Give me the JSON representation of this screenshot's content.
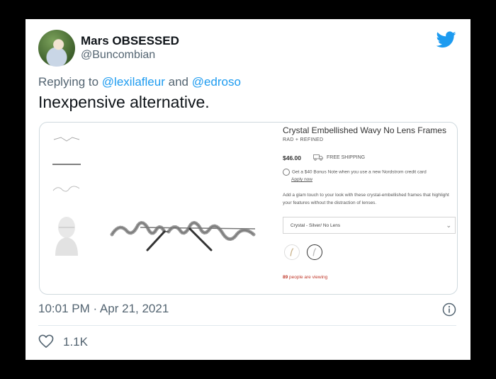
{
  "tweet": {
    "display_name": "Mars OBSESSED",
    "handle": "@Buncombian",
    "replying_prefix": "Replying to",
    "reply_mentions": [
      "@lexilafleur",
      "@edroso"
    ],
    "reply_and": "and",
    "text": "Inexpensive alternative.",
    "timestamp": "10:01 PM · Apr 21, 2021",
    "likes": "1.1K",
    "brand_color": "#1d9bf0"
  },
  "product": {
    "title": "Crystal Embellished Wavy No Lens Frames",
    "brand": "RAD + REFINED",
    "price": "$46.00",
    "shipping": "FREE SHIPPING",
    "bonus": "Get a $40 Bonus Note when you use a new Nordstrom credit card",
    "apply": "Apply now",
    "description": "Add a glam touch to your look with these crystal-embellished frames that highlight your features without the distraction of lenses.",
    "color_selected": "Crystal - Silver/ No Lens",
    "viewing_count": "89",
    "viewing_text": "people are viewing",
    "accent_color": "#c0392b"
  }
}
